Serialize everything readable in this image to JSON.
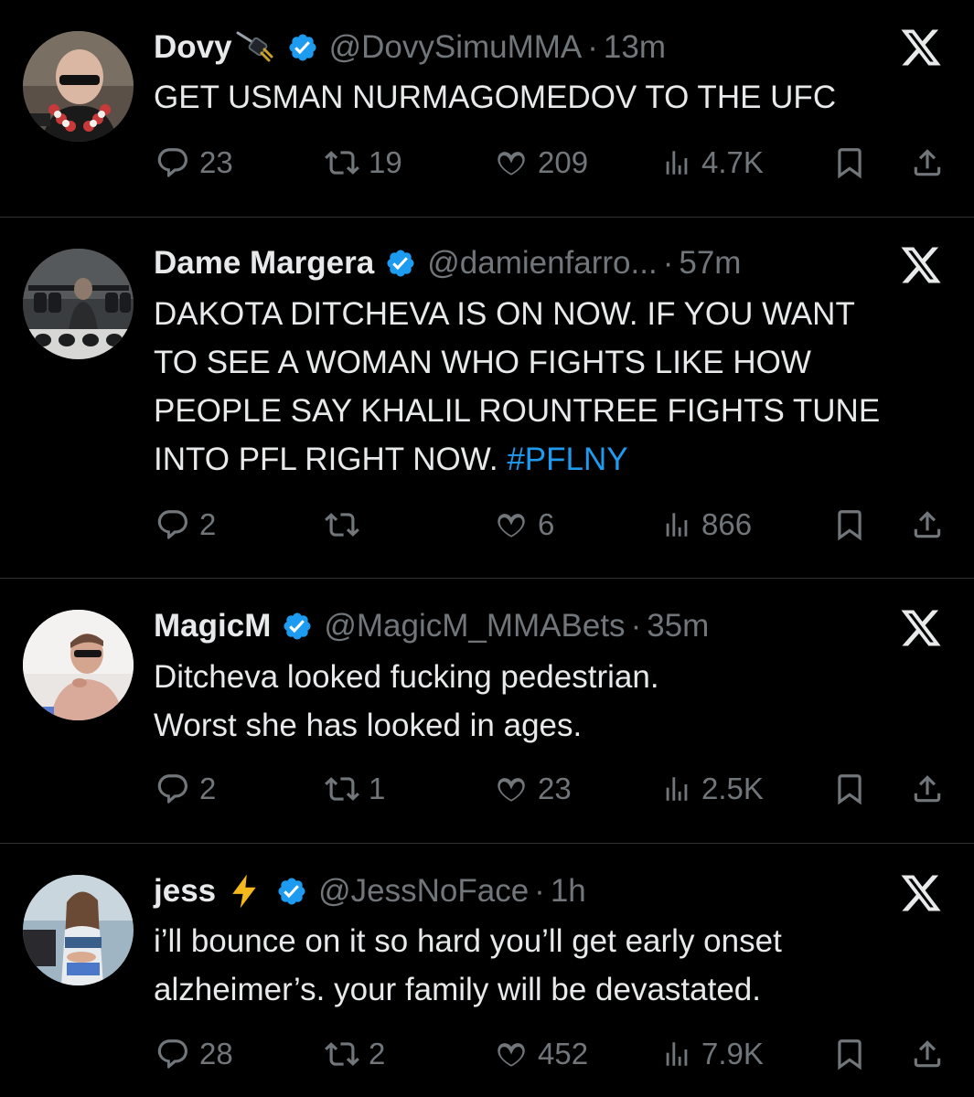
{
  "tweets": [
    {
      "name": "Dovy",
      "name_emoji": "plug-icon",
      "handle": "@DovySimuMMA",
      "separator": "·",
      "time": "13m",
      "text": [
        "GET USMAN NURMAGOMEDOV TO THE UFC"
      ],
      "hashtag": "",
      "replies": "23",
      "retweets": "19",
      "likes": "209",
      "views": "4.7K"
    },
    {
      "name": "Dame Margera",
      "name_emoji": "",
      "handle": "@damienfarro...",
      "separator": "·",
      "time": "57m",
      "text": [
        "DAKOTA DITCHEVA IS ON NOW. IF YOU WANT",
        "TO SEE A WOMAN WHO FIGHTS LIKE HOW",
        "PEOPLE SAY KHALIL ROUNTREE FIGHTS TUNE",
        "INTO PFL RIGHT NOW."
      ],
      "hashtag": "#PFLNY",
      "replies": "2",
      "retweets": "",
      "likes": "6",
      "views": "866"
    },
    {
      "name": "MagicM",
      "name_emoji": "",
      "handle": "@MagicM_MMABets",
      "separator": "·",
      "time": "35m",
      "text": [
        "Ditcheva looked fucking pedestrian.",
        "Worst she has looked in ages."
      ],
      "hashtag": "",
      "replies": "2",
      "retweets": "1",
      "likes": "23",
      "views": "2.5K"
    },
    {
      "name": "jess",
      "name_emoji": "lightning-icon",
      "handle": "@JessNoFace",
      "separator": "·",
      "time": "1h",
      "text": [
        "i’ll bounce on it so hard you’ll get early onset",
        "alzheimer’s. your family will be devastated."
      ],
      "hashtag": "",
      "replies": "28",
      "retweets": "2",
      "likes": "452",
      "views": "7.9K"
    }
  ],
  "colors": {
    "background": "#000000",
    "text": "#e7e9ea",
    "muted": "#71767b",
    "verified": "#1d9bf0",
    "hashtag": "#1d9bf0",
    "divider": "#2f3336"
  }
}
